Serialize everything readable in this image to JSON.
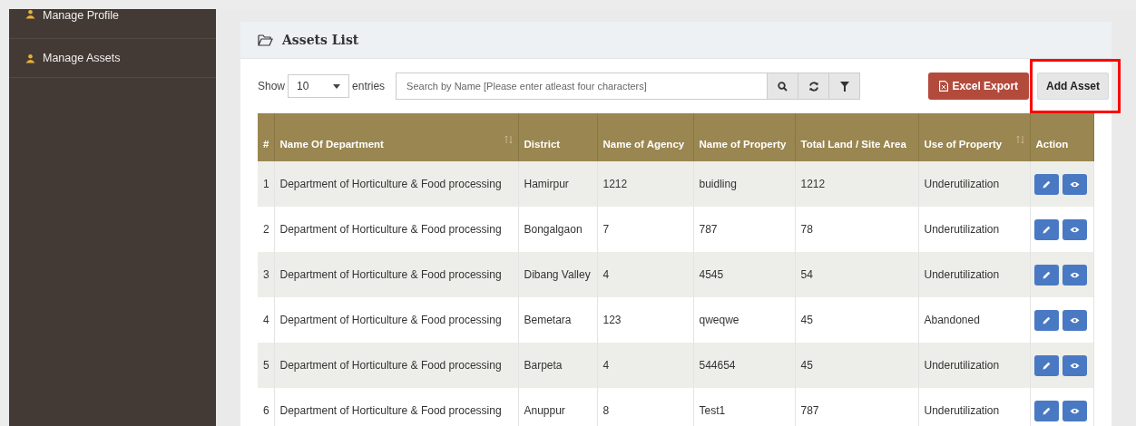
{
  "sidebar": {
    "items": [
      {
        "label": "Manage Profile"
      },
      {
        "label": "Manage Assets"
      }
    ]
  },
  "panel": {
    "title": "Assets List",
    "length_control": {
      "show_label": "Show",
      "value": "10",
      "entries_label": "entries"
    },
    "search": {
      "placeholder": "Search by Name [Please enter atleast four characters]"
    },
    "buttons": [
      {
        "label": "Excel Export",
        "kind": "export",
        "highlighted": false
      },
      {
        "label": "Add Asset",
        "kind": "add",
        "highlighted": true
      }
    ],
    "table": {
      "columns": [
        {
          "label": "#",
          "sortable": false
        },
        {
          "label": "Name Of Department",
          "sortable": true
        },
        {
          "label": "District",
          "sortable": false
        },
        {
          "label": "Name of Agency",
          "sortable": false
        },
        {
          "label": "Name of Property",
          "sortable": false
        },
        {
          "label": "Total Land / Site Area",
          "sortable": false
        },
        {
          "label": "Use of Property",
          "sortable": true
        },
        {
          "label": "Action",
          "sortable": false
        }
      ],
      "rows": [
        {
          "cells": [
            "1",
            "Department of Horticulture & Food processing",
            "Hamirpur",
            "1212",
            "buidling",
            "1212",
            "Underutilization"
          ]
        },
        {
          "cells": [
            "2",
            "Department of Horticulture & Food processing",
            "Bongalgaon",
            "7",
            "787",
            "78",
            "Underutilization"
          ]
        },
        {
          "cells": [
            "3",
            "Department of Horticulture & Food processing",
            "Dibang Valley",
            "4",
            "4545",
            "54",
            "Underutilization"
          ]
        },
        {
          "cells": [
            "4",
            "Department of Horticulture & Food processing",
            "Bemetara",
            "123",
            "qweqwe",
            "45",
            "Abandoned"
          ]
        },
        {
          "cells": [
            "5",
            "Department of Horticulture & Food processing",
            "Barpeta",
            "4",
            "544654",
            "45",
            "Underutilization"
          ]
        },
        {
          "cells": [
            "6",
            "Department of Horticulture & Food processing",
            "Anuppur",
            "8",
            "Test1",
            "787",
            "Underutilization"
          ]
        }
      ]
    }
  }
}
